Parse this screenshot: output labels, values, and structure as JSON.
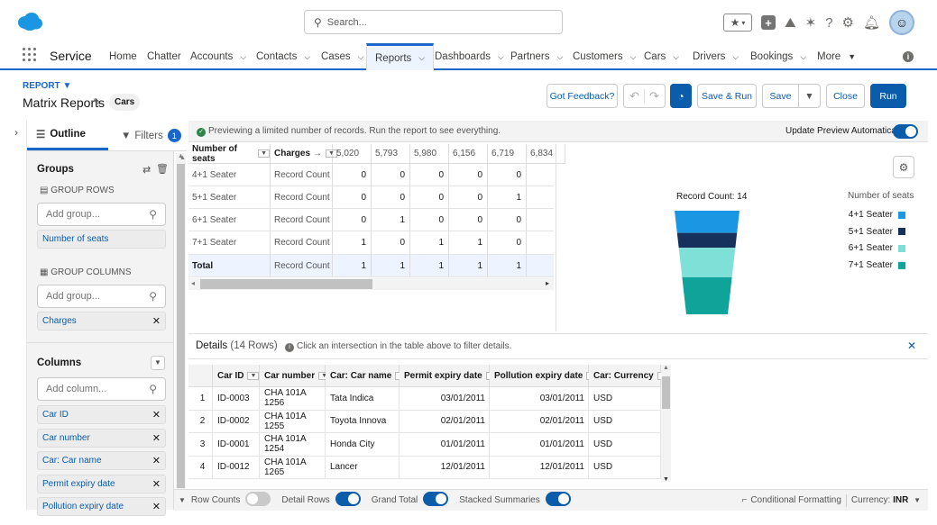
{
  "header": {
    "search_placeholder": "Search...",
    "app_name": "Service"
  },
  "nav": {
    "items": [
      {
        "label": "Home",
        "dropdown": false
      },
      {
        "label": "Chatter",
        "dropdown": false
      },
      {
        "label": "Accounts",
        "dropdown": true
      },
      {
        "label": "Contacts",
        "dropdown": true
      },
      {
        "label": "Cases",
        "dropdown": true
      },
      {
        "label": "Reports",
        "dropdown": true,
        "active": true
      },
      {
        "label": "Dashboards",
        "dropdown": true
      },
      {
        "label": "Partners",
        "dropdown": true
      },
      {
        "label": "Customers",
        "dropdown": true
      },
      {
        "label": "Cars",
        "dropdown": true
      },
      {
        "label": "Drivers",
        "dropdown": true
      },
      {
        "label": "Bookings",
        "dropdown": true
      },
      {
        "label": "More",
        "dropdown": true
      }
    ]
  },
  "report": {
    "label": "REPORT",
    "title": "Matrix Reports",
    "type_chip": "Cars"
  },
  "actions": {
    "feedback": "Got Feedback?",
    "save_run": "Save & Run",
    "save": "Save",
    "close": "Close",
    "run": "Run"
  },
  "outline": {
    "tab_outline": "Outline",
    "tab_filters": "Filters",
    "filters_count": "1",
    "groups_title": "Groups",
    "group_rows_label": "GROUP ROWS",
    "add_group_placeholder": "Add group...",
    "group_rows": [
      "Number of seats"
    ],
    "group_columns_label": "GROUP COLUMNS",
    "group_columns": [
      "Charges"
    ],
    "columns_title": "Columns",
    "add_column_placeholder": "Add column...",
    "columns": [
      "Car ID",
      "Car number",
      "Car: Car name",
      "Permit expiry date",
      "Pollution expiry date"
    ]
  },
  "preview": {
    "message": "Previewing a limited number of records. Run the report to see everything.",
    "auto_update_label": "Update Preview Automatically"
  },
  "matrix": {
    "row_header": "Number of seats",
    "col_header": "Charges",
    "arrow": "→",
    "columns": [
      "5,020",
      "5,793",
      "5,980",
      "6,156",
      "6,719",
      "6,834"
    ],
    "rows": [
      {
        "label": "4+1 Seater",
        "measure": "Record Count",
        "values": [
          "0",
          "0",
          "0",
          "0",
          "0"
        ]
      },
      {
        "label": "5+1 Seater",
        "measure": "Record Count",
        "values": [
          "0",
          "0",
          "0",
          "0",
          "1"
        ]
      },
      {
        "label": "6+1 Seater",
        "measure": "Record Count",
        "values": [
          "0",
          "1",
          "0",
          "0",
          "0"
        ]
      },
      {
        "label": "7+1 Seater",
        "measure": "Record Count",
        "values": [
          "1",
          "0",
          "1",
          "1",
          "0"
        ]
      }
    ],
    "total": {
      "label": "Total",
      "measure": "Record Count",
      "values": [
        "1",
        "1",
        "1",
        "1",
        "1"
      ]
    }
  },
  "chart_data": {
    "type": "funnel",
    "title": "Record Count: 14",
    "legend_title": "Number of seats",
    "legend_position": "right",
    "series": [
      {
        "name": "4+1 Seater",
        "value": 3,
        "color": "#1b96e3"
      },
      {
        "name": "5+1 Seater",
        "value": 2,
        "color": "#16325c"
      },
      {
        "name": "6+1 Seater",
        "value": 4,
        "color": "#7fe0d7"
      },
      {
        "name": "7+1 Seater",
        "value": 5,
        "color": "#0fa39a"
      }
    ]
  },
  "details": {
    "title": "Details",
    "count": "(14 Rows)",
    "hint": "Click an intersection in the table above to filter details.",
    "columns": [
      "Car ID",
      "Car number",
      "Car: Car name",
      "Permit expiry date",
      "Pollution expiry date",
      "Car: Currency"
    ],
    "rows": [
      [
        "1",
        "ID-0003",
        "CHA 101A 1256",
        "Tata Indica",
        "03/01/2011",
        "03/01/2011",
        "USD"
      ],
      [
        "2",
        "ID-0002",
        "CHA 101A 1255",
        "Toyota Innova",
        "02/01/2011",
        "02/01/2011",
        "USD"
      ],
      [
        "3",
        "ID-0001",
        "CHA 101A 1254",
        "Honda City",
        "01/01/2011",
        "01/01/2011",
        "USD"
      ],
      [
        "4",
        "ID-0012",
        "CHA 101A 1265",
        "Lancer",
        "12/01/2011",
        "12/01/2011",
        "USD"
      ]
    ]
  },
  "footer": {
    "row_counts": "Row Counts",
    "detail_rows": "Detail Rows",
    "grand_total": "Grand Total",
    "stacked_summaries": "Stacked Summaries",
    "conditional_formatting": "Conditional Formatting",
    "currency_label": "Currency:",
    "currency_value": "INR",
    "toggles": {
      "row_counts": false,
      "detail_rows": true,
      "grand_total": true,
      "stacked_summaries": true
    }
  }
}
